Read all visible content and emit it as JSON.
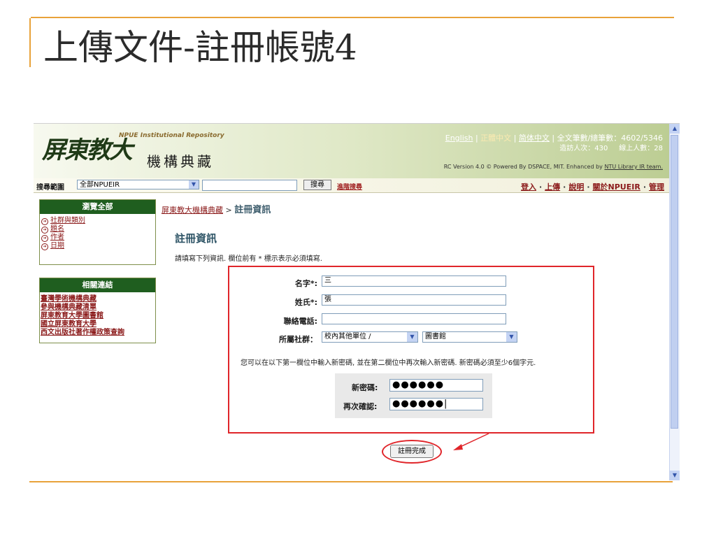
{
  "slide": {
    "title": "上傳文件-註冊帳號4",
    "accent_color": "#e8a23a"
  },
  "header": {
    "logo_calligraphy": "屏東教大",
    "logo_english": "NPUE Institutional Repository",
    "logo_chinese": "機構典藏",
    "lang_english": "English",
    "lang_traditional": "正體中文",
    "lang_simplified": "简体中文",
    "stats_label": "全文筆數/總筆數：4602/5346",
    "visits_label": "造訪人次：430",
    "online_label": "線上人數：28",
    "powered_by_text": "RC Version 4.0 © Powered By DSPACE, MIT. Enhanced by",
    "powered_by_link": "NTU Library IR team."
  },
  "searchbar": {
    "scope_label": "搜尋範圍",
    "scope_value": "全部NPUEIR",
    "query_value": "",
    "search_button": "搜尋",
    "advanced_link": "進階搜尋",
    "nav_login": "登入",
    "nav_upload": "上傳",
    "nav_help": "說明",
    "nav_about": "關於NPUEIR",
    "nav_admin": "管理"
  },
  "sidebar": {
    "browse_title": "瀏覽全部",
    "browse_items": [
      {
        "label": "社群與類別"
      },
      {
        "label": "題名"
      },
      {
        "label": "作者"
      },
      {
        "label": "日期"
      }
    ],
    "related_title": "相關連結",
    "related_items": [
      {
        "label": "臺灣學術機構典藏"
      },
      {
        "label": "參與機構典藏清單"
      },
      {
        "label": "屏東教育大學圖書館"
      },
      {
        "label": "國立屏東教育大學"
      },
      {
        "label": "西文出版社著作權政策查詢"
      }
    ]
  },
  "main": {
    "breadcrumb_home": "屏東教大機構典藏",
    "breadcrumb_sep": ">",
    "breadcrumb_current": "註冊資訊",
    "heading": "註冊資訊",
    "instruction": "請填寫下列資訊. 欄位前有 * 標示表示必須填寫.",
    "form": {
      "first_name_label": "名字*:",
      "first_name_value": "三",
      "last_name_label": "姓氏*:",
      "last_name_value": "張",
      "phone_label": "聯絡電話:",
      "phone_value": "",
      "affiliation_label": "所屬社群：",
      "affiliation_value_1": "校內其他單位 /",
      "affiliation_value_2": "圖書館",
      "password_note": "您可以在以下第一欄位中輸入新密碼, 並在第二欄位中再次輸入新密碼. 新密碼必須至少6個字元.",
      "new_password_label": "新密碼:",
      "new_password_value": "●●●●●●",
      "confirm_password_label": "再次確認:",
      "confirm_password_value": "●●●●●●|"
    },
    "submit_button": "註冊完成",
    "highlight_color": "#e0252a"
  },
  "scrollbar": {
    "up_arrow": "▲",
    "down_arrow": "▼"
  }
}
